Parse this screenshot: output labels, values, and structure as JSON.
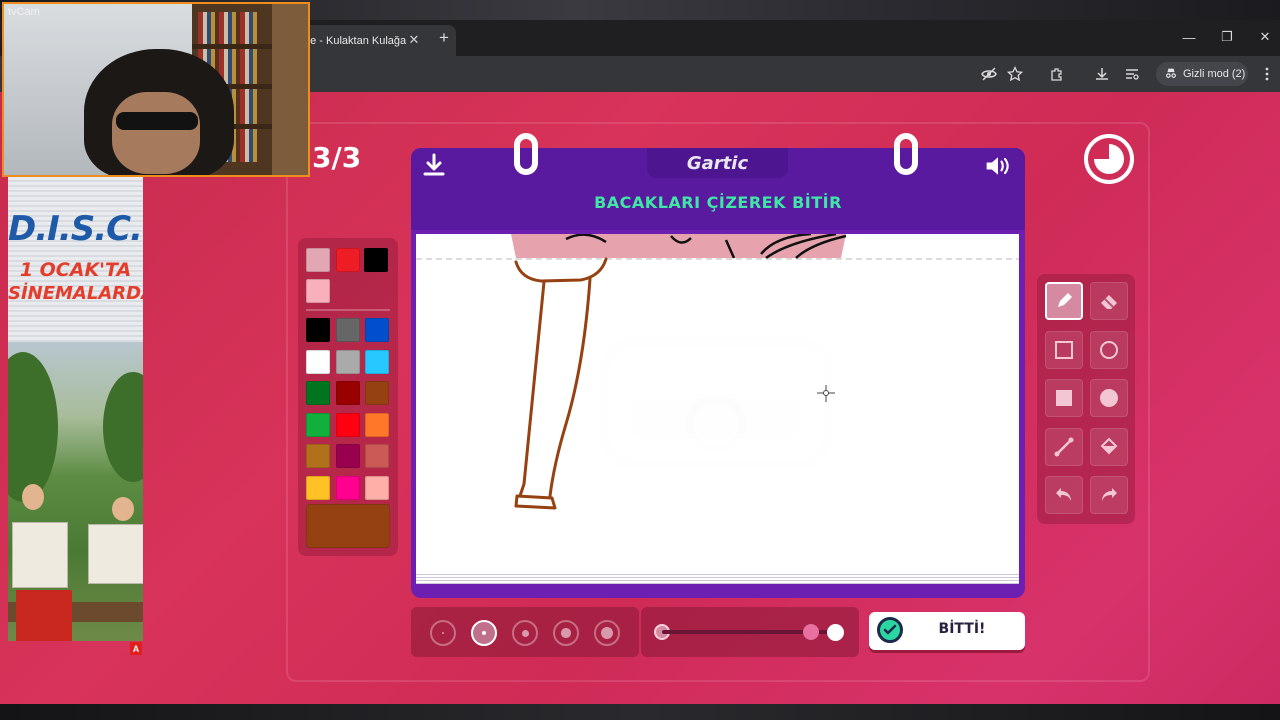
{
  "browser": {
    "tab_title": "ne - Kulaktan Kulağa",
    "tab_close": "✕",
    "new_tab": "+",
    "window_buttons": [
      "—",
      "❐",
      "✕"
    ],
    "incognito_label": "Gizli mod (2)",
    "toolbar_icons": [
      "eye-off-icon",
      "star-icon",
      "extensions-icon",
      "download-icon",
      "tab-search-icon",
      "incognito-icon",
      "menu-icon"
    ]
  },
  "webcam": {
    "label": "tvCam"
  },
  "ad": {
    "title": "D.I.S.C.O.",
    "date": "1 OCAK'TA",
    "subtitle": "SİNEMALARDA",
    "badge": "A"
  },
  "game": {
    "round": "3/3",
    "logo": "Gartic",
    "instruction": "BACAKLARI ÇİZEREK BİTİR",
    "done_label": "BİTTİ!"
  },
  "palette": {
    "top_colors": [
      "#e3a7b4",
      "#ee1c24",
      "#000000",
      "#f7b0bc"
    ],
    "colors": [
      "#000000",
      "#666666",
      "#0050cd",
      "#ffffff",
      "#aaaaaa",
      "#26c9ff",
      "#017420",
      "#990000",
      "#964112",
      "#11b03c",
      "#ff0013",
      "#ff7829",
      "#b0701c",
      "#99004e",
      "#cb5a57",
      "#ffc126",
      "#ff008f",
      "#feafa8"
    ],
    "selected_color": "#964112"
  },
  "tools": [
    {
      "name": "pencil-tool",
      "icon": "pencil-icon",
      "active": true
    },
    {
      "name": "eraser-tool",
      "icon": "eraser-icon",
      "active": false
    },
    {
      "name": "rectangle-outline-tool",
      "icon": "square-outline-icon",
      "active": false
    },
    {
      "name": "ellipse-outline-tool",
      "icon": "circle-outline-icon",
      "active": false
    },
    {
      "name": "rectangle-fill-tool",
      "icon": "square-fill-icon",
      "active": false
    },
    {
      "name": "ellipse-fill-tool",
      "icon": "circle-fill-icon",
      "active": false
    },
    {
      "name": "line-tool",
      "icon": "line-icon",
      "active": false
    },
    {
      "name": "fill-bucket-tool",
      "icon": "bucket-icon",
      "active": false
    },
    {
      "name": "undo-tool",
      "icon": "undo-icon",
      "active": false
    },
    {
      "name": "redo-tool",
      "icon": "redo-icon",
      "active": false
    }
  ],
  "brush_sizes": {
    "count": 5,
    "selected_index": 1
  },
  "opacity": {
    "value_fraction": 0.85
  }
}
